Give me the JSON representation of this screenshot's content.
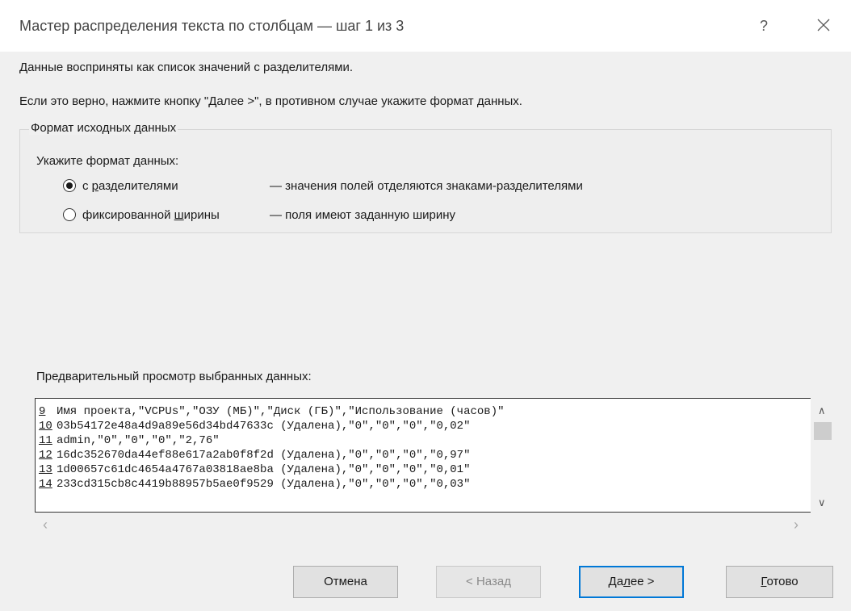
{
  "window": {
    "title": "Мастер распределения текста по столбцам — шаг 1 из 3",
    "help_label": "?",
    "close_icon": "close-icon"
  },
  "info": {
    "line1": "Данные восприняты как список значений с разделителями.",
    "line2": "Если это верно, нажмите кнопку \"Далее >\", в противном случае укажите формат данных."
  },
  "format_group": {
    "legend": "Формат исходных данных",
    "prompt": "Укажите формат данных:",
    "options": [
      {
        "label_before": "с ",
        "label_accel": "р",
        "label_after": "азделителями",
        "description": "— значения полей отделяются знаками-разделителями",
        "selected": true
      },
      {
        "label_before": "фиксированной ",
        "label_accel": "ш",
        "label_after": "ирины",
        "description": "— поля имеют заданную ширину",
        "selected": false
      }
    ]
  },
  "preview": {
    "label": "Предварительный просмотр выбранных данных:",
    "rows": [
      {
        "num": "9",
        "text": "Имя проекта,\"VCPUs\",\"ОЗУ (МБ)\",\"Диск (ГБ)\",\"Использование (часов)\""
      },
      {
        "num": "10",
        "text": "03b54172e48a4d9a89e56d34bd47633c (Удалена),\"0\",\"0\",\"0\",\"0,02\""
      },
      {
        "num": "11",
        "text": "admin,\"0\",\"0\",\"0\",\"2,76\""
      },
      {
        "num": "12",
        "text": "16dc352670da44ef88e617a2ab0f8f2d (Удалена),\"0\",\"0\",\"0\",\"0,97\""
      },
      {
        "num": "13",
        "text": "1d00657c61dc4654a4767a03818ae8ba (Удалена),\"0\",\"0\",\"0\",\"0,01\""
      },
      {
        "num": "14",
        "text": "233cd315cb8c4419b88957b5ae0f9529 (Удалена),\"0\",\"0\",\"0\",\"0,03\""
      }
    ]
  },
  "buttons": {
    "cancel": "Отмена",
    "back": "< Назад",
    "next_before": "Да",
    "next_accel": "л",
    "next_after": "ее >",
    "finish_accel": "Г",
    "finish_after": "отово"
  },
  "colors": {
    "accent": "#0078d7",
    "title_bg": "#ffffff",
    "dialog_bg": "#f0f0f0"
  }
}
